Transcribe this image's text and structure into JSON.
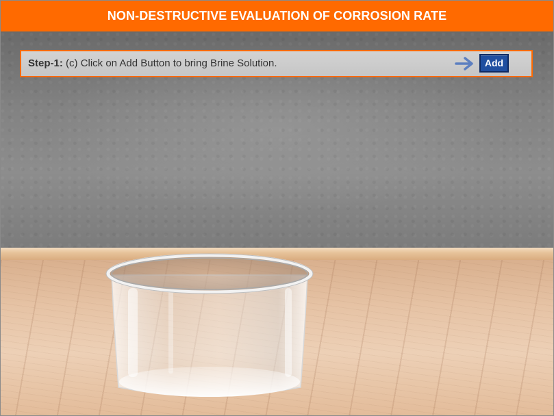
{
  "header": {
    "title": "NON-DESTRUCTIVE EVALUATION OF CORROSION RATE"
  },
  "instruction": {
    "step_label": "Step-1:",
    "step_text": " (c) Click on Add Button to bring Brine Solution.",
    "arrow_icon": "arrow-right-icon",
    "add_button_label": "Add"
  },
  "colors": {
    "accent": "#ff6a00",
    "button": "#1f4fa0",
    "arrow": "#5c7fc0"
  }
}
